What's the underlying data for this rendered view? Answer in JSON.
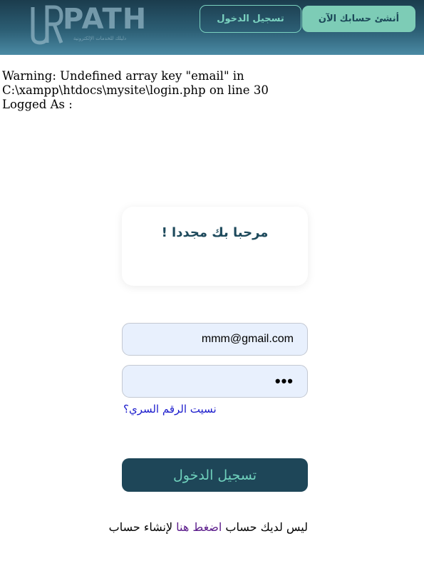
{
  "header": {
    "logo": {
      "word": "PATH",
      "mark": "UR",
      "tagline": "دليلك للخدمات الإلكترونية"
    },
    "login_button": "تسجيل الدخول",
    "signup_button": "أنشئ حسابك الآن"
  },
  "warning": {
    "line1": "Warning: Undefined array key \"email\" in",
    "line2": "C:\\xampp\\htdocs\\mysite\\login.php on line 30",
    "line3": "Logged As :"
  },
  "welcome": {
    "title": "مرحبا بك مجددا !"
  },
  "form": {
    "email_value": "mmm@gmail.com",
    "password_masked": "•••",
    "forgot_link": "نسيت الرقم السري؟",
    "submit_label": "تسجيل الدخول"
  },
  "signup": {
    "prefix": "ليس لديك حساب ",
    "link": "اضغط هنا",
    "suffix": " لإنشاء حساب"
  },
  "colors": {
    "header_dark": "#1b3c4d",
    "accent_teal": "#7dccb6",
    "button_dark": "#1e4658",
    "link_blue": "#1a1acc",
    "link_purple": "#5a1a8a"
  }
}
